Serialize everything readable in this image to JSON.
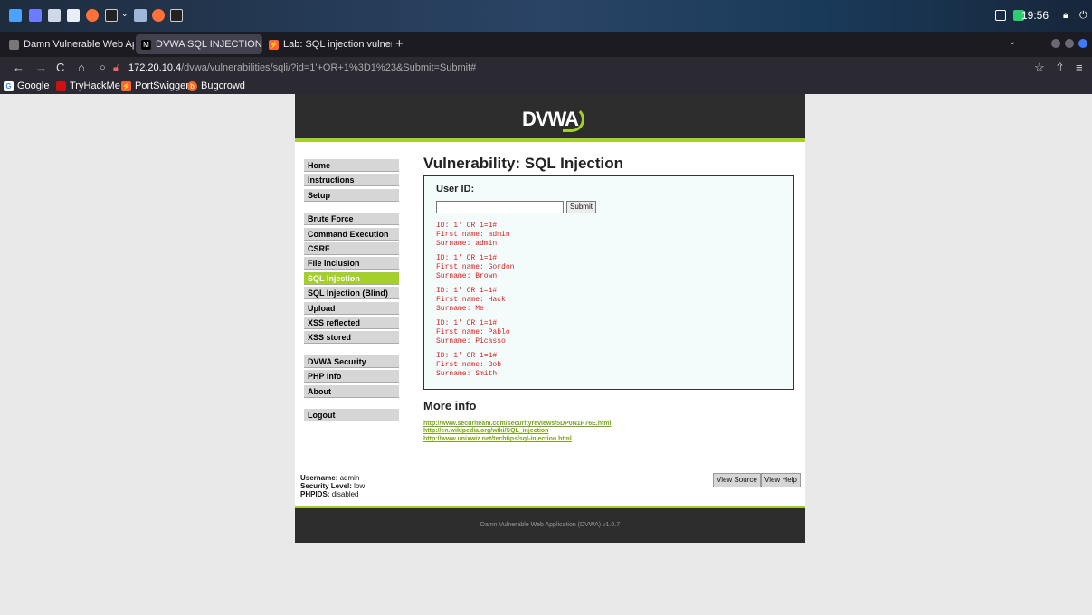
{
  "taskbar": {
    "clock": "19:56"
  },
  "tabs": [
    {
      "label": "Damn Vulnerable Web Ap",
      "active": false
    },
    {
      "label": "DVWA SQL INJECTION. |",
      "active": true
    },
    {
      "label": "Lab: SQL injection vulner",
      "active": false
    }
  ],
  "tabbar": {
    "new_tab": "+",
    "list": "⌄"
  },
  "nav": {
    "back": "←",
    "forward": "→",
    "reload": "C",
    "home": "⌂",
    "url_host": "172.20.10.4",
    "url_path": "/dvwa/vulnerabilities/sqli/?id=1'+OR+1%3D1%23&Submit=Submit#",
    "bookmark_star": "☆",
    "share": "⇧",
    "menu": "≡"
  },
  "bookmarks": [
    "Google",
    "TryHackMe",
    "PortSwigger",
    "Bugcrowd"
  ],
  "dvwa": {
    "logo": "DVWA",
    "menu": {
      "group1": [
        "Home",
        "Instructions",
        "Setup"
      ],
      "group2": [
        "Brute Force",
        "Command Execution",
        "CSRF",
        "File Inclusion",
        "SQL Injection",
        "SQL Injection (Blind)",
        "Upload",
        "XSS reflected",
        "XSS stored"
      ],
      "group3": [
        "DVWA Security",
        "PHP Info",
        "About"
      ],
      "group4": [
        "Logout"
      ],
      "selected": "SQL Injection"
    },
    "title": "Vulnerability: SQL Injection",
    "userid_label": "User ID:",
    "submit_label": "Submit",
    "results": [
      {
        "id": "ID: 1' OR 1=1#",
        "first": "First name: admin",
        "surname": "Surname: admin"
      },
      {
        "id": "ID: 1' OR 1=1#",
        "first": "First name: Gordon",
        "surname": "Surname: Brown"
      },
      {
        "id": "ID: 1' OR 1=1#",
        "first": "First name: Hack",
        "surname": "Surname: Me"
      },
      {
        "id": "ID: 1' OR 1=1#",
        "first": "First name: Pablo",
        "surname": "Surname: Picasso"
      },
      {
        "id": "ID: 1' OR 1=1#",
        "first": "First name: Bob",
        "surname": "Surname: Smith"
      }
    ],
    "more_info_title": "More info",
    "links": [
      "http://www.securiteam.com/securityreviews/5DP0N1P76E.html",
      "http://en.wikipedia.org/wiki/SQL_injection",
      "http://www.unixwiz.net/techtips/sql-injection.html"
    ],
    "user_info": {
      "username_label": "Username:",
      "username": "admin",
      "security_label": "Security Level:",
      "security": "low",
      "phpids_label": "PHPIDS:",
      "phpids": "disabled"
    },
    "view_source": "View Source",
    "view_help": "View Help",
    "footer": "Damn Vulnerable Web Application (DVWA) v1.0.7"
  },
  "colors": {
    "accent": "#a5cf2c",
    "result_text": "#e02020",
    "header_bg": "#2d2d2d"
  }
}
